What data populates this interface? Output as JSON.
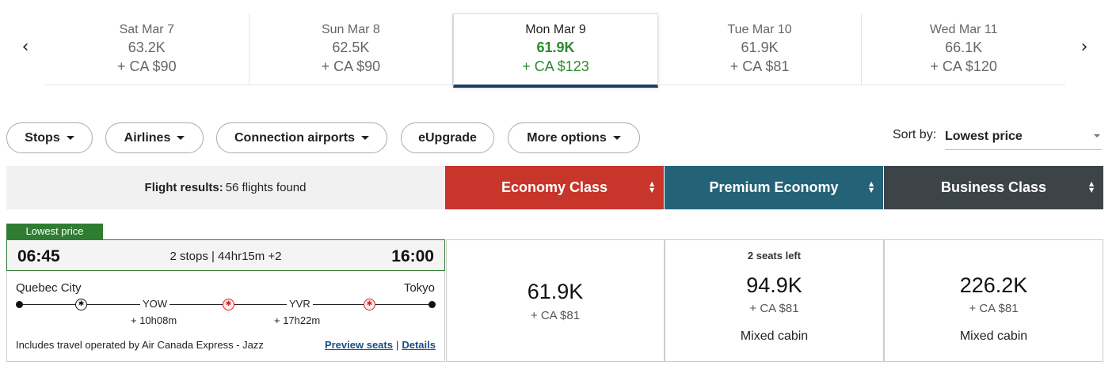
{
  "date_nav": {
    "prev_icon": "‹",
    "next_icon": "›",
    "dates": [
      {
        "label": "Sat Mar 7",
        "points": "63.2K",
        "cash": "+ CA $90"
      },
      {
        "label": "Sun Mar 8",
        "points": "62.5K",
        "cash": "+ CA $90"
      },
      {
        "label": "Mon Mar 9",
        "points": "61.9K",
        "cash": "+ CA $123"
      },
      {
        "label": "Tue Mar 10",
        "points": "61.9K",
        "cash": "+ CA $81"
      },
      {
        "label": "Wed Mar 11",
        "points": "66.1K",
        "cash": "+ CA $120"
      }
    ]
  },
  "filters": {
    "stops": "Stops",
    "airlines": "Airlines",
    "connection_airports": "Connection airports",
    "eupgrade": "eUpgrade",
    "more_options": "More options"
  },
  "sort": {
    "label": "Sort by:",
    "value": "Lowest price"
  },
  "results": {
    "label": "Flight results:",
    "count_text": "56 flights found"
  },
  "cabins": {
    "economy": "Economy Class",
    "premium": "Premium Economy",
    "business": "Business Class",
    "colors": {
      "economy": "#c8352b",
      "premium": "#246377",
      "business": "#3c4448"
    }
  },
  "flight": {
    "badge": "Lowest price",
    "departure_time": "06:45",
    "arrival_time": "16:00",
    "summary": "2 stops | 44hr15m +2",
    "origin": "Quebec City",
    "destination": "Tokyo",
    "connections": [
      {
        "airport": "YOW",
        "layover": "+ 10h08m"
      },
      {
        "airport": "YVR",
        "layover": "+ 17h22m"
      }
    ],
    "operated_by": "Includes travel operated by Air Canada Express - Jazz",
    "preview_seats": "Preview seats",
    "separator": "|",
    "details": "Details",
    "fares": {
      "economy": {
        "points": "61.9K",
        "cash": "+ CA $81"
      },
      "premium": {
        "seats_left": "2 seats left",
        "points": "94.9K",
        "cash": "+ CA $81",
        "note": "Mixed cabin"
      },
      "business": {
        "points": "226.2K",
        "cash": "+ CA $81",
        "note": "Mixed cabin"
      }
    }
  }
}
